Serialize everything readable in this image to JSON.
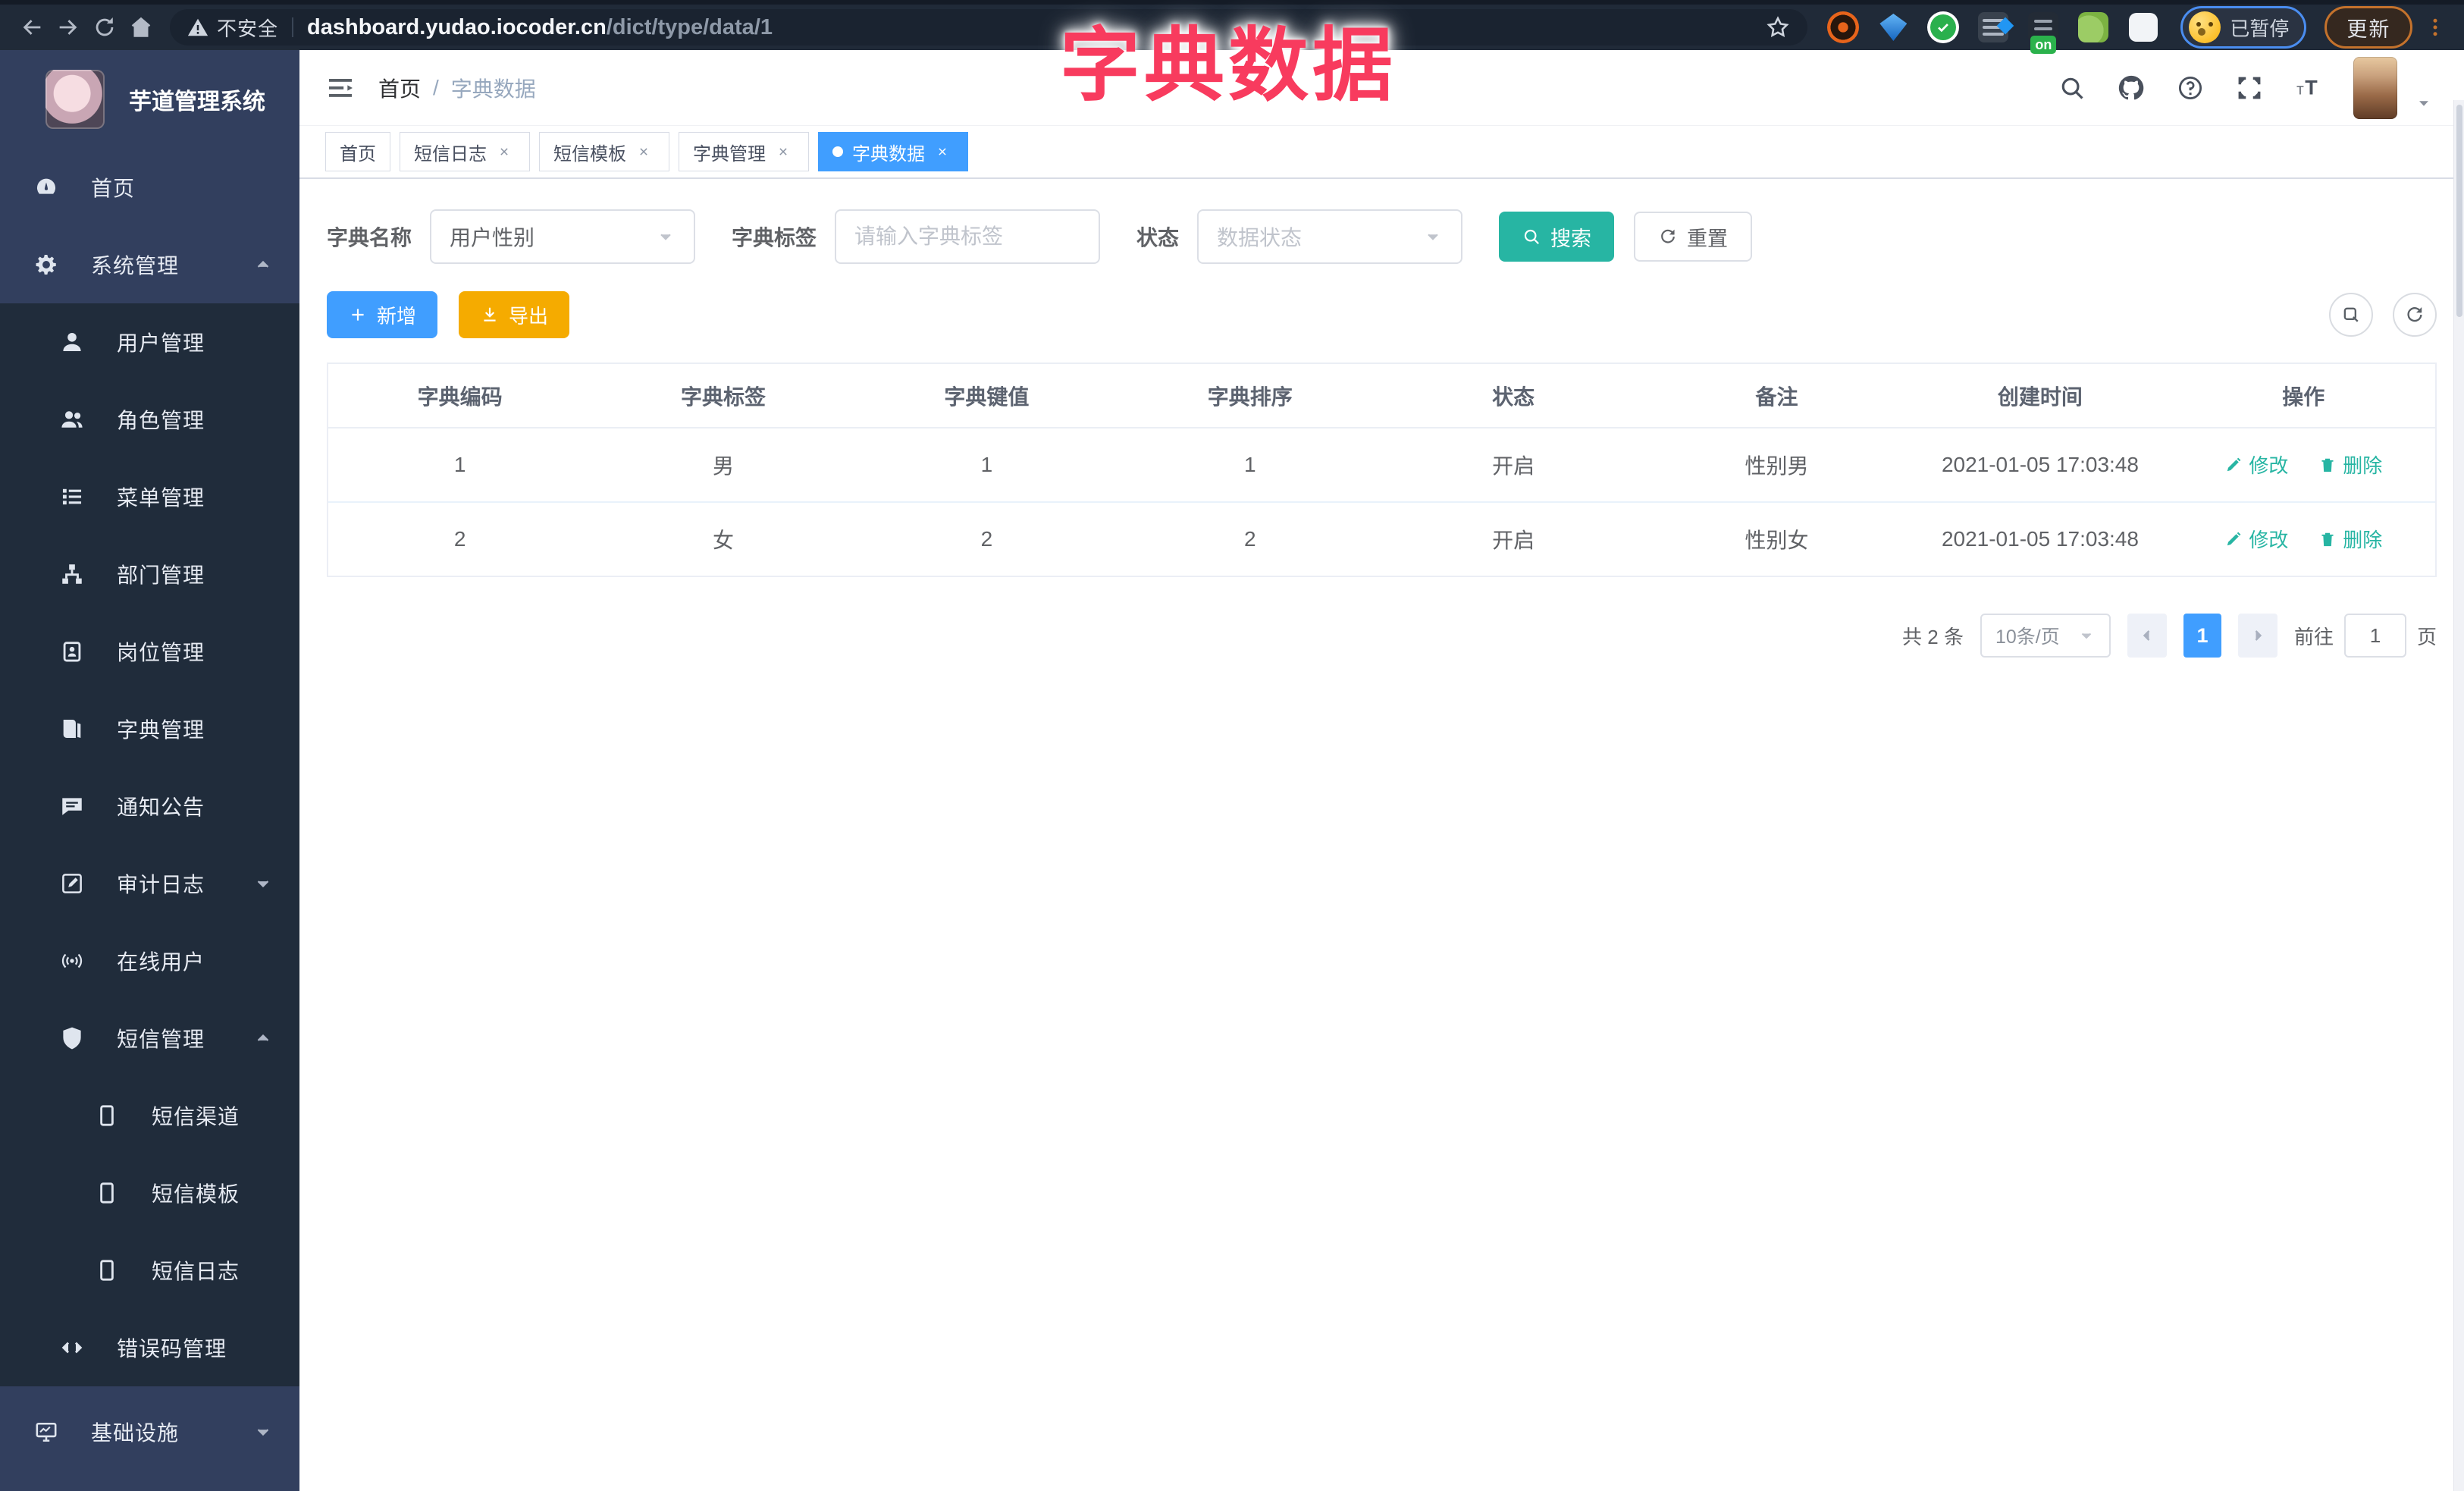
{
  "browser": {
    "security_label": "不安全",
    "url_host": "dashboard.yudao.iocoder.cn",
    "url_path": "/dict/type/data/1",
    "profile_status": "已暂停",
    "update_label": "更新",
    "extension_badge": "on"
  },
  "annotation": {
    "title": "字典数据"
  },
  "sidebar": {
    "logo_title": "芋道管理系统",
    "items": [
      {
        "label": "首页",
        "icon": "dashboard",
        "level": 1
      },
      {
        "label": "系统管理",
        "icon": "gear",
        "level": 1,
        "chevron": "up"
      },
      {
        "label": "用户管理",
        "icon": "user",
        "level": 2
      },
      {
        "label": "角色管理",
        "icon": "users",
        "level": 2
      },
      {
        "label": "菜单管理",
        "icon": "menu-list",
        "level": 2
      },
      {
        "label": "部门管理",
        "icon": "org-tree",
        "level": 2
      },
      {
        "label": "岗位管理",
        "icon": "badge",
        "level": 2
      },
      {
        "label": "字典管理",
        "icon": "dict-book",
        "level": 2
      },
      {
        "label": "通知公告",
        "icon": "announcement",
        "level": 2
      },
      {
        "label": "审计日志",
        "icon": "audit-log",
        "level": 2,
        "chevron": "down"
      },
      {
        "label": "在线用户",
        "icon": "online-user",
        "level": 2
      },
      {
        "label": "短信管理",
        "icon": "sms-shield",
        "level": 2,
        "chevron": "up"
      },
      {
        "label": "短信渠道",
        "icon": "phone",
        "level": 3
      },
      {
        "label": "短信模板",
        "icon": "phone",
        "level": 3
      },
      {
        "label": "短信日志",
        "icon": "phone",
        "level": 3
      },
      {
        "label": "错误码管理",
        "icon": "code",
        "level": 2
      },
      {
        "label": "基础设施",
        "icon": "monitor",
        "level": 1,
        "chevron": "down"
      }
    ]
  },
  "header": {
    "breadcrumb_home": "首页",
    "breadcrumb_sep": "/",
    "breadcrumb_current": "字典数据"
  },
  "tabs": [
    {
      "label": "首页",
      "closable": false,
      "active": false
    },
    {
      "label": "短信日志",
      "closable": true,
      "active": false
    },
    {
      "label": "短信模板",
      "closable": true,
      "active": false
    },
    {
      "label": "字典管理",
      "closable": true,
      "active": false
    },
    {
      "label": "字典数据",
      "closable": true,
      "active": true
    }
  ],
  "filters": {
    "dict_name_label": "字典名称",
    "dict_name_value": "用户性别",
    "dict_label_label": "字典标签",
    "dict_label_placeholder": "请输入字典标签",
    "status_label": "状态",
    "status_placeholder": "数据状态",
    "search_label": "搜索",
    "reset_label": "重置"
  },
  "toolbar": {
    "add_label": "新增",
    "export_label": "导出"
  },
  "table": {
    "headers": [
      "字典编码",
      "字典标签",
      "字典键值",
      "字典排序",
      "状态",
      "备注",
      "创建时间",
      "操作"
    ],
    "rows": [
      {
        "code": "1",
        "label": "男",
        "value": "1",
        "sort": "1",
        "status": "开启",
        "remark": "性别男",
        "created": "2021-01-05 17:03:48"
      },
      {
        "code": "2",
        "label": "女",
        "value": "2",
        "sort": "2",
        "status": "开启",
        "remark": "性别女",
        "created": "2021-01-05 17:03:48"
      }
    ],
    "edit_label": "修改",
    "delete_label": "删除"
  },
  "pagination": {
    "total_text": "共 2 条",
    "page_size": "10条/页",
    "current_page": "1",
    "goto_label": "前往",
    "goto_value": "1",
    "page_unit": "页"
  },
  "colors": {
    "accent_blue": "#409eff",
    "teal": "#27b5a3",
    "warning_yellow": "#f5ab00",
    "annotation_red": "#f83b5e",
    "sidebar_root": "#323f5e",
    "sidebar_sub": "#202c3b",
    "chrome_bg": "#202a38"
  }
}
